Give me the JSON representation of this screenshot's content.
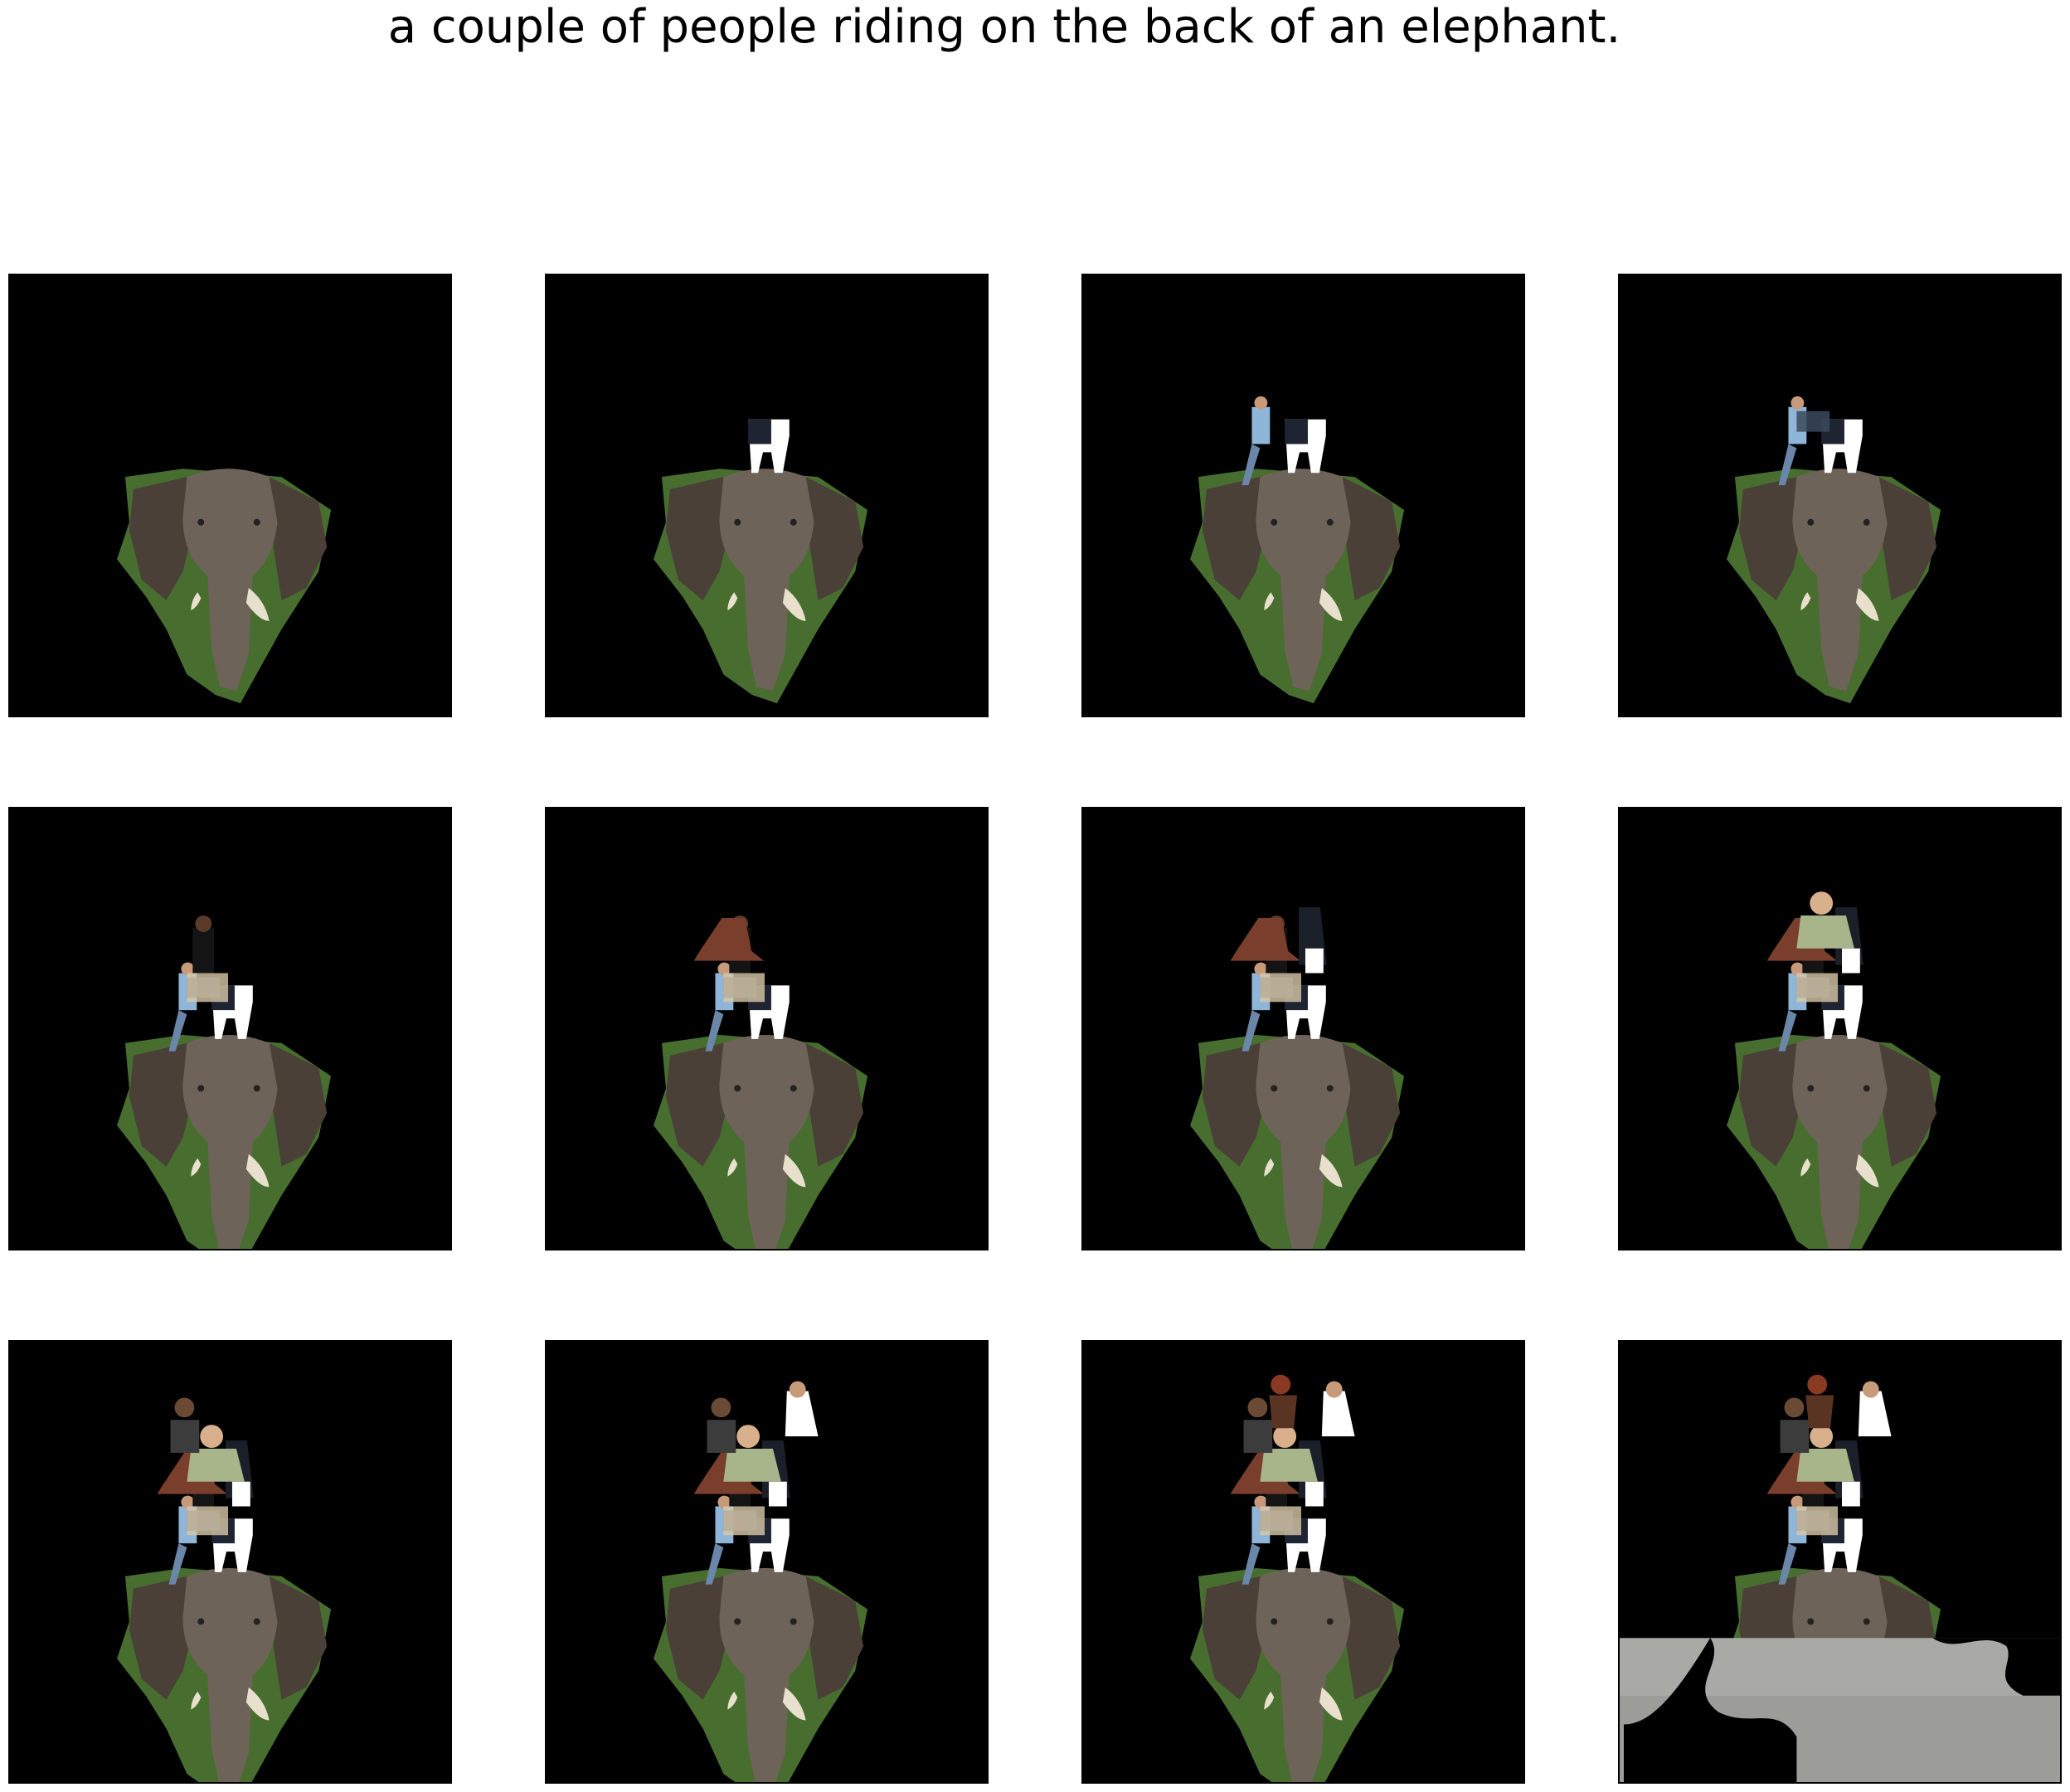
{
  "figure": {
    "title": "a couple of people riding on the back of an elephant."
  },
  "panels": [
    {
      "step": 1,
      "layers": [
        "elephant"
      ]
    },
    {
      "step": 2,
      "layers": [
        "elephant",
        "person-a"
      ]
    },
    {
      "step": 3,
      "layers": [
        "elephant",
        "person-a",
        "person-b"
      ]
    },
    {
      "step": 4,
      "layers": [
        "elephant",
        "person-a",
        "person-b",
        "person-c"
      ]
    },
    {
      "step": 5,
      "layers": [
        "elephant",
        "person-a",
        "person-b",
        "person-c",
        "person-d"
      ]
    },
    {
      "step": 6,
      "layers": [
        "elephant",
        "person-a",
        "person-b",
        "person-c",
        "person-d",
        "saddle"
      ]
    },
    {
      "step": 7,
      "layers": [
        "elephant",
        "person-a",
        "person-b",
        "person-c",
        "person-d",
        "saddle",
        "person-e"
      ]
    },
    {
      "step": 8,
      "layers": [
        "elephant",
        "person-a",
        "person-b",
        "person-c",
        "person-d",
        "saddle",
        "person-e",
        "person-f"
      ]
    },
    {
      "step": 9,
      "layers": [
        "elephant",
        "person-a",
        "person-b",
        "person-c",
        "person-d",
        "saddle",
        "person-e",
        "person-f",
        "person-g"
      ]
    },
    {
      "step": 10,
      "layers": [
        "elephant",
        "person-a",
        "person-b",
        "person-c",
        "person-d",
        "saddle",
        "person-e",
        "person-f",
        "person-g",
        "person-h"
      ]
    },
    {
      "step": 11,
      "layers": [
        "elephant",
        "person-a",
        "person-b",
        "person-c",
        "person-d",
        "saddle",
        "person-e",
        "person-f",
        "person-g",
        "person-h",
        "person-i"
      ]
    },
    {
      "step": 12,
      "layers": [
        "elephant",
        "person-a",
        "person-b",
        "person-c",
        "person-d",
        "saddle",
        "person-e",
        "person-f",
        "person-g",
        "person-h",
        "person-i",
        "ground"
      ]
    }
  ],
  "colors": {
    "background": "#000000",
    "elephant": "#6e6358",
    "elephant_dark": "#4a4038",
    "foliage": "#4f7a34",
    "tusk": "#e8e0cc",
    "saddle": "#7a3e2c",
    "ground": "#a9a9a6"
  }
}
